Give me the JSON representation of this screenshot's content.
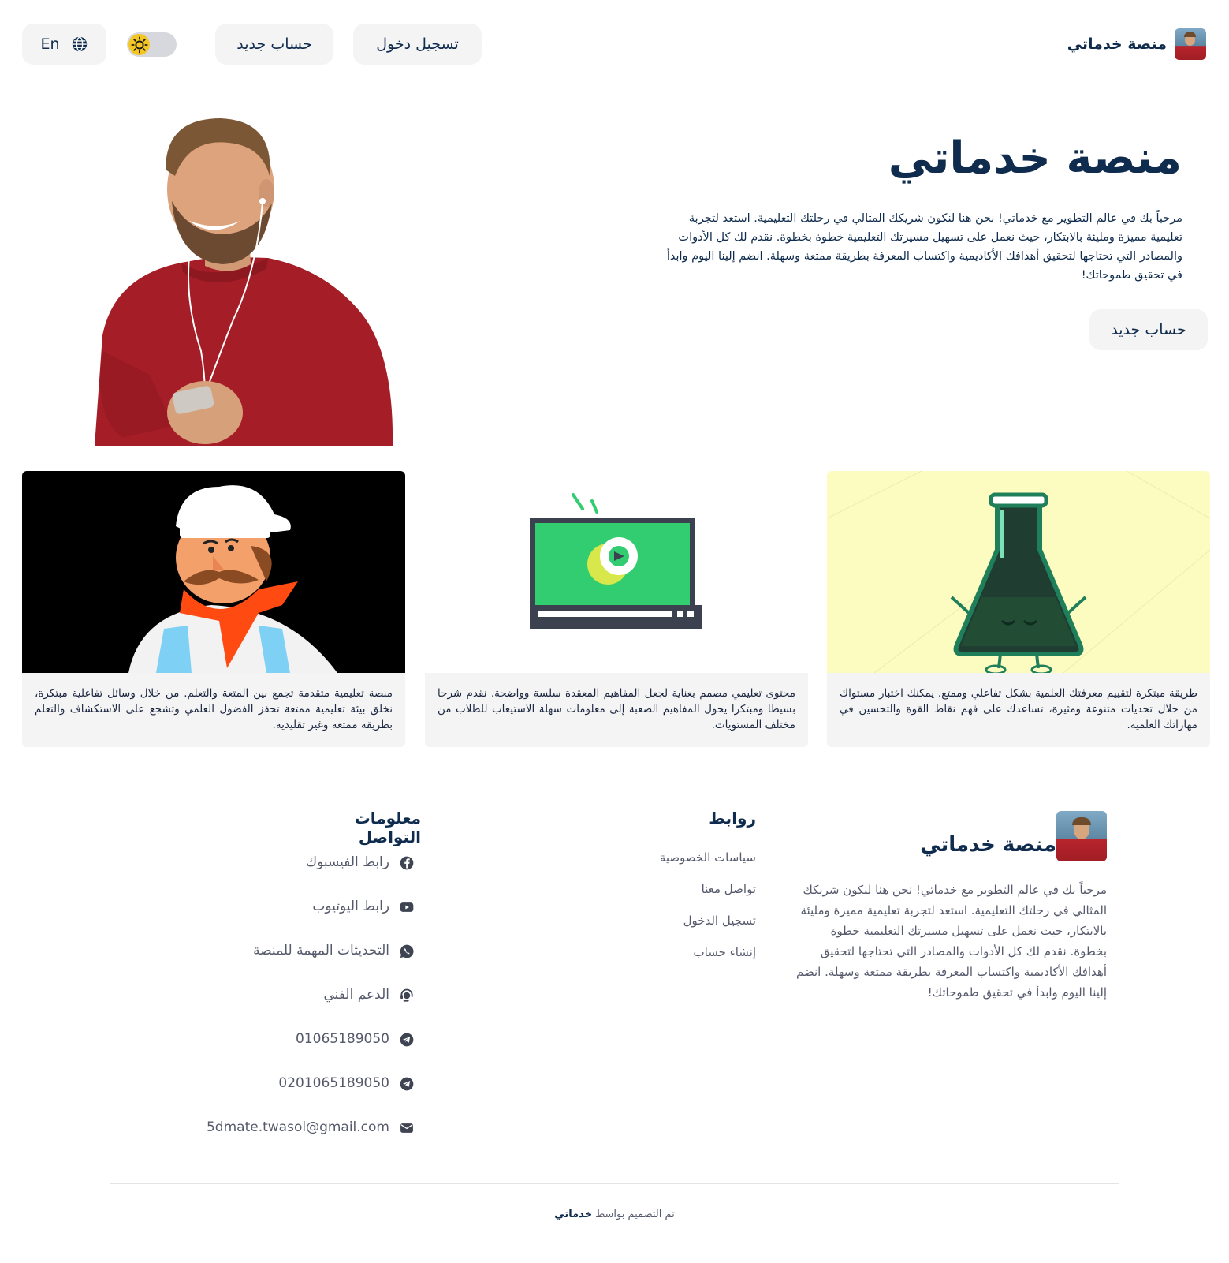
{
  "header": {
    "brand": "منصة خدماتي",
    "login_label": "تسجيل دخول",
    "register_label": "حساب جديد",
    "lang_label": "En",
    "theme_toggle_icon": "sun-icon",
    "lang_icon": "globe-icon"
  },
  "hero": {
    "title": "منصة خدماتي",
    "description": "مرحباً بك في عالم التطوير مع خدماتي! نحن هنا لنكون شريكك المثالي في رحلتك التعليمية. استعد لتجربة تعليمية مميزة ومليئة بالابتكار، حيث نعمل على تسهيل مسيرتك التعليمية خطوة بخطوة. نقدم لك كل الأدوات والمصادر التي تحتاجها لتحقيق أهدافك الأكاديمية واكتساب المعرفة بطريقة ممتعة وسهلة. انضم إلينا اليوم وابدأ في تحقيق طموحاتك!",
    "cta_label": "حساب جديد"
  },
  "cards": [
    {
      "image": "chemistry-flask-illustration",
      "text": "طريقة مبتكرة لتقييم معرفتك العلمية بشكل تفاعلي وممتع. يمكنك اختبار مستواك من خلال تحديات متنوعة ومثيرة، تساعدك على فهم نقاط القوة والتحسين في مهاراتك العلمية."
    },
    {
      "image": "video-player-illustration",
      "text": "محتوى تعليمي مصمم بعناية لجعل المفاهيم المعقدة سلسة وواضحة. نقدم شرحا بسيطا ومبتكرا يحول المفاهيم الصعبة إلى معلومات سهلة الاستيعاب للطلاب من مختلف المستويات."
    },
    {
      "image": "chef-illustration",
      "text": "منصة تعليمية متقدمة تجمع بين المتعة والتعلم. من خلال وسائل تفاعلية مبتكرة، نخلق بيئة تعليمية ممتعة تحفز الفضول العلمي وتشجع على الاستكشاف والتعلم بطريقة ممتعة وغير تقليدية."
    }
  ],
  "footer": {
    "brand": "منصة خدماتي",
    "description": "مرحباً بك في عالم التطوير مع خدماتي! نحن هنا لنكون شريكك المثالي في رحلتك التعليمية. استعد لتجربة تعليمية مميزة ومليئة بالابتكار، حيث نعمل على تسهيل مسيرتك التعليمية خطوة بخطوة. نقدم لك كل الأدوات والمصادر التي تحتاجها لتحقيق أهدافك الأكاديمية واكتساب المعرفة بطريقة ممتعة وسهلة. انضم إلينا اليوم وابدأ في تحقيق طموحاتك!",
    "links_title": "روابط",
    "links": [
      "سياسات الخصوصية",
      "تواصل معنا",
      "تسجيل الدخول",
      "إنشاء حساب"
    ],
    "contact_title": "معلومات التواصل",
    "contacts": [
      {
        "icon": "facebook-icon",
        "label": "رابط الفيسبوك"
      },
      {
        "icon": "youtube-icon",
        "label": "رابط اليوتيوب"
      },
      {
        "icon": "whatsapp-icon",
        "label": "التحديثات المهمة للمنصة"
      },
      {
        "icon": "support-icon",
        "label": "الدعم الفني"
      },
      {
        "icon": "telegram-icon",
        "label": "01065189050"
      },
      {
        "icon": "telegram-icon",
        "label": "0201065189050"
      },
      {
        "icon": "mail-icon",
        "label": "5dmate.twasol@gmail.com"
      }
    ],
    "credit_prefix": "تم التصميم بواسط",
    "credit_brand": "خدماتي"
  },
  "colors": {
    "primary_text": "#0f2b4d",
    "muted_text": "#55596b",
    "button_bg": "#f4f4f5",
    "card_bg": "#f5f4f4",
    "toggle_sun": "#f3c623"
  }
}
